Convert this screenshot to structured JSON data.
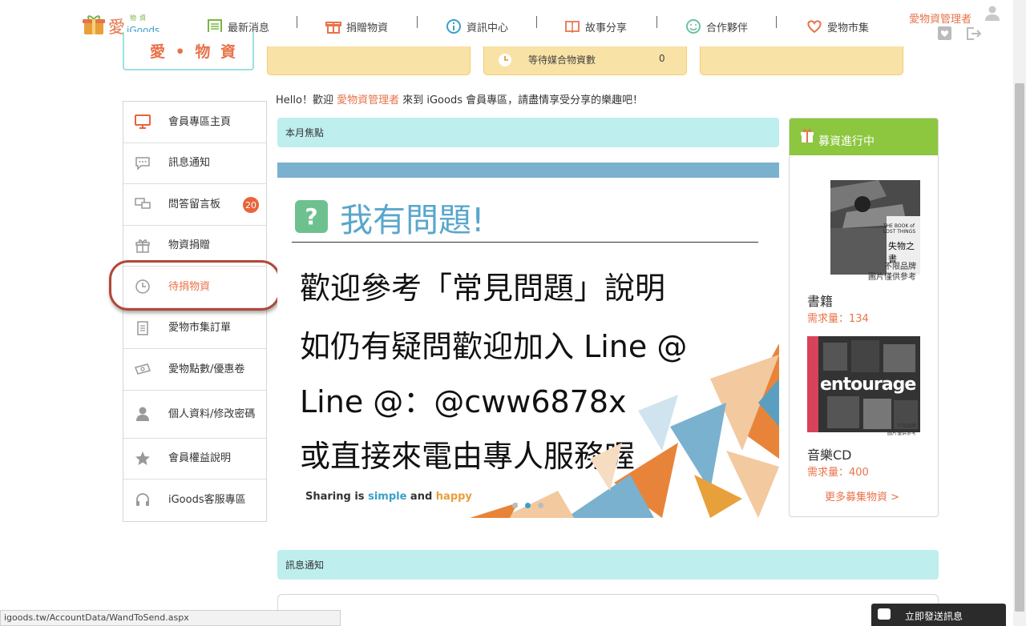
{
  "header": {
    "logo": {
      "brand_char": "愛",
      "small_text": "物資",
      "latin": "iGoods"
    },
    "nav": [
      {
        "label": "最新消息",
        "icon": "news-icon"
      },
      {
        "label": "捐贈物資",
        "icon": "donate-icon"
      },
      {
        "label": "資訊中心",
        "icon": "info-icon"
      },
      {
        "label": "故事分享",
        "icon": "book-icon"
      },
      {
        "label": "合作夥伴",
        "icon": "smile-icon"
      },
      {
        "label": "愛物市集",
        "icon": "heart-icon"
      }
    ],
    "admin_name": "愛物資管理者"
  },
  "top": {
    "brand_box": "愛 • 物 資",
    "stat_pending_label": "等待媒合物資數",
    "stat_pending_value": "0"
  },
  "welcome": {
    "prefix": "Hello！歡迎 ",
    "user": "愛物資管理者",
    "suffix": " 來到 iGoods 會員專區，請盡情享受分享的樂趣吧！"
  },
  "sidebar": {
    "items": [
      {
        "label": "會員專區主頁",
        "icon": "monitor-icon"
      },
      {
        "label": "訊息通知",
        "icon": "message-icon"
      },
      {
        "label": "問答留言板",
        "icon": "chat-icon",
        "badge": "20"
      },
      {
        "label": "物資捐贈",
        "icon": "gift-icon"
      },
      {
        "label": "待捐物資",
        "icon": "clock-icon"
      },
      {
        "label": "愛物市集訂單",
        "icon": "document-icon"
      },
      {
        "label": "愛物點數/優惠卷",
        "icon": "coupon-icon"
      },
      {
        "label": "個人資料/修改密碼",
        "icon": "person-icon"
      },
      {
        "label": "會員權益說明",
        "icon": "star-icon"
      },
      {
        "label": "iGoods客服專區",
        "icon": "headset-icon"
      }
    ],
    "active_index": 4
  },
  "main": {
    "focus_title": "本月焦點",
    "banner": {
      "title": "我有問題!",
      "lines": [
        "歡迎參考「常見問題」說明",
        "如仍有疑問歡迎加入 Line @",
        "Line @：@cww6878x",
        "或直接來電由專人服務喔"
      ],
      "tagline_1": "Sharing is ",
      "tagline_2": "simple",
      "tagline_3": " and ",
      "tagline_4": "happy"
    },
    "message_title": "訊息通知"
  },
  "fund": {
    "title": "募資進行中",
    "items": [
      {
        "name": "書籍",
        "need": "需求量：134",
        "note_1": "不限品牌",
        "note_2": "圖片僅供參考",
        "cover_text_1": "THE BOOK of",
        "cover_text_2": "LOST THINGS",
        "cover_text_3": "失物之書"
      },
      {
        "name": "音樂CD",
        "need": "需求量：400",
        "note_1": "不限品牌",
        "note_2": "圖片僅供參考",
        "cover_text_1": "entourage"
      }
    ],
    "more": "更多募集物資 >"
  },
  "status_url": "igoods.tw/AccountData/WandToSend.aspx",
  "chat_button": "立即發送訊息",
  "colors": {
    "accent": "#e8734a",
    "teal": "#bfeeee",
    "green": "#8dc63f",
    "ring": "#b0483a"
  }
}
